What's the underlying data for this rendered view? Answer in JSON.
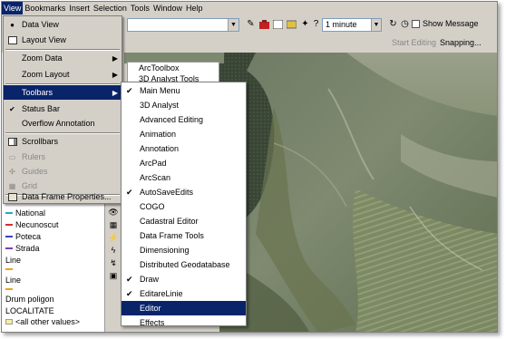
{
  "menubar": [
    "View",
    "Bookmarks",
    "Insert",
    "Selection",
    "Tools",
    "Window",
    "Help"
  ],
  "toolbar": {
    "interval": "1 minute",
    "show_message": "Show Message",
    "start_editing": "Start Editing",
    "snapping": "Snapping..."
  },
  "view_menu": [
    {
      "label": "Data View",
      "checked": true
    },
    {
      "label": "Layout View"
    },
    {
      "label": "Zoom Data",
      "submenu": true
    },
    {
      "label": "Zoom Layout",
      "submenu": true
    },
    {
      "label": "Toolbars",
      "submenu": true,
      "highlighted": true
    },
    {
      "label": "Status Bar",
      "checked": true
    },
    {
      "label": "Overflow Annotation"
    },
    {
      "label": "Scrollbars"
    },
    {
      "label": "Rulers",
      "disabled": true
    },
    {
      "label": "Guides",
      "disabled": true
    },
    {
      "label": "Grid",
      "disabled": true
    },
    {
      "label": "Data Frame Properties..."
    }
  ],
  "toolbars_menu": [
    {
      "label": "Main Menu",
      "checked": true
    },
    {
      "label": "3D Analyst"
    },
    {
      "label": "Advanced Editing"
    },
    {
      "label": "Animation"
    },
    {
      "label": "Annotation"
    },
    {
      "label": "ArcPad"
    },
    {
      "label": "ArcScan"
    },
    {
      "label": "AutoSaveEdits",
      "checked": true
    },
    {
      "label": "COGO"
    },
    {
      "label": "Cadastral Editor"
    },
    {
      "label": "Data Frame Tools"
    },
    {
      "label": "Dimensioning"
    },
    {
      "label": "Distributed Geodatabase"
    },
    {
      "label": "Draw",
      "checked": true
    },
    {
      "label": "EditareLinie",
      "checked": true
    },
    {
      "label": "Editor",
      "highlighted": true
    },
    {
      "label": "Effects"
    }
  ],
  "arctoolbox": {
    "title": "ArcToolbox",
    "item": "3D Analyst Tools"
  },
  "toc": [
    {
      "label": "National",
      "color": "#2aa9c8"
    },
    {
      "label": "Necunoscut",
      "color": "#d03030"
    },
    {
      "label": "Poteca",
      "color": "#4040c0"
    },
    {
      "label": "Strada",
      "color": "#7a3fb0"
    },
    {
      "label": "Line",
      "color": ""
    },
    {
      "label": "",
      "color": "#f0a020"
    },
    {
      "label": "Line",
      "color": ""
    },
    {
      "label": "",
      "color": "#f0a020"
    },
    {
      "label": "Drum poligon",
      "color": ""
    },
    {
      "label": "LOCALITATE",
      "color": ""
    },
    {
      "label": "<all other values>",
      "color": "#f8f0a0"
    }
  ]
}
